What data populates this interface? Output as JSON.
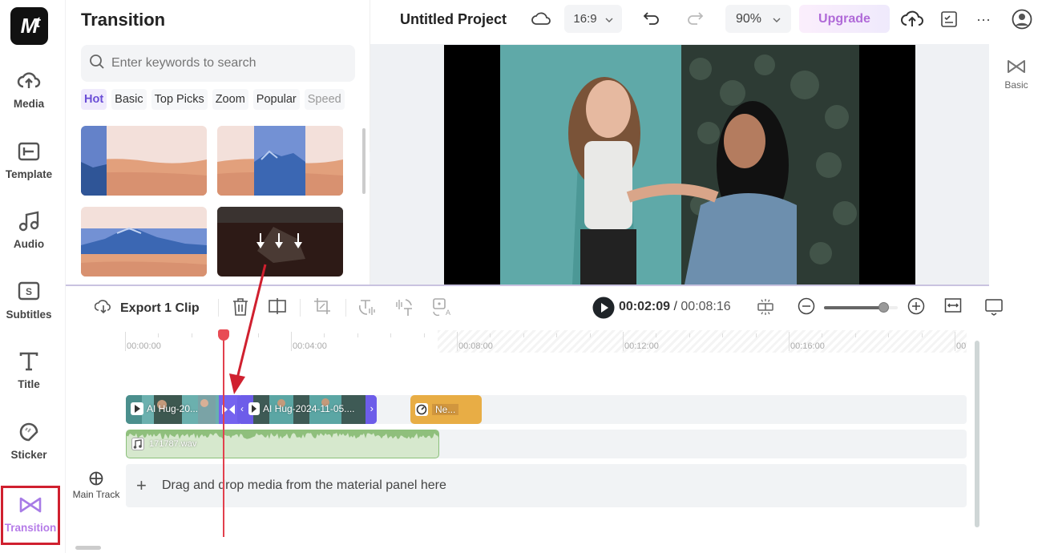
{
  "app": {
    "logo_text": "M"
  },
  "nav": {
    "items": [
      {
        "label": "Media",
        "icon": "cloud-upload-icon"
      },
      {
        "label": "Template",
        "icon": "template-icon"
      },
      {
        "label": "Audio",
        "icon": "music-note-icon"
      },
      {
        "label": "Subtitles",
        "icon": "subtitles-icon"
      },
      {
        "label": "Title",
        "icon": "text-title-icon"
      },
      {
        "label": "Sticker",
        "icon": "sticker-icon"
      },
      {
        "label": "Transition",
        "icon": "bowtie-transition-icon",
        "active": true
      }
    ]
  },
  "panel": {
    "title": "Transition",
    "search_placeholder": "Enter keywords to search",
    "chips": [
      "Hot",
      "Basic",
      "Top Picks",
      "Zoom",
      "Popular",
      "Speed"
    ],
    "active_chip": "Hot"
  },
  "header": {
    "project_title": "Untitled Project",
    "aspect_ratio": "16:9",
    "zoom": "90%",
    "upgrade_label": "Upgrade"
  },
  "right_rail": {
    "basic_label": "Basic"
  },
  "toolbar": {
    "export_label": "Export 1 Clip",
    "current_time": "00:02:09",
    "separator": " / ",
    "total_time": "00:08:16",
    "zoom_level": 0.8
  },
  "timeline": {
    "ruler_labels": [
      "00:00:00",
      "00:04:00",
      "00:08:00",
      "00:12:00",
      "00:16:00",
      "00"
    ],
    "clips": [
      {
        "label": "AI Hug-20...",
        "type": "video"
      },
      {
        "label": "AI Hug-2024-11-05....",
        "type": "video"
      },
      {
        "label": "Ne...",
        "type": "effect"
      }
    ],
    "audio": {
      "label": "171787.wav"
    },
    "main_track_label": "Main Track",
    "drop_hint": "Drag and drop media from the material panel here"
  },
  "colors": {
    "accent": "#6b4ed6",
    "transition_active": "#b57be8",
    "playhead": "#e2404d",
    "upgrade_text": "#b06ad8",
    "annotation_red": "#d0202f"
  }
}
